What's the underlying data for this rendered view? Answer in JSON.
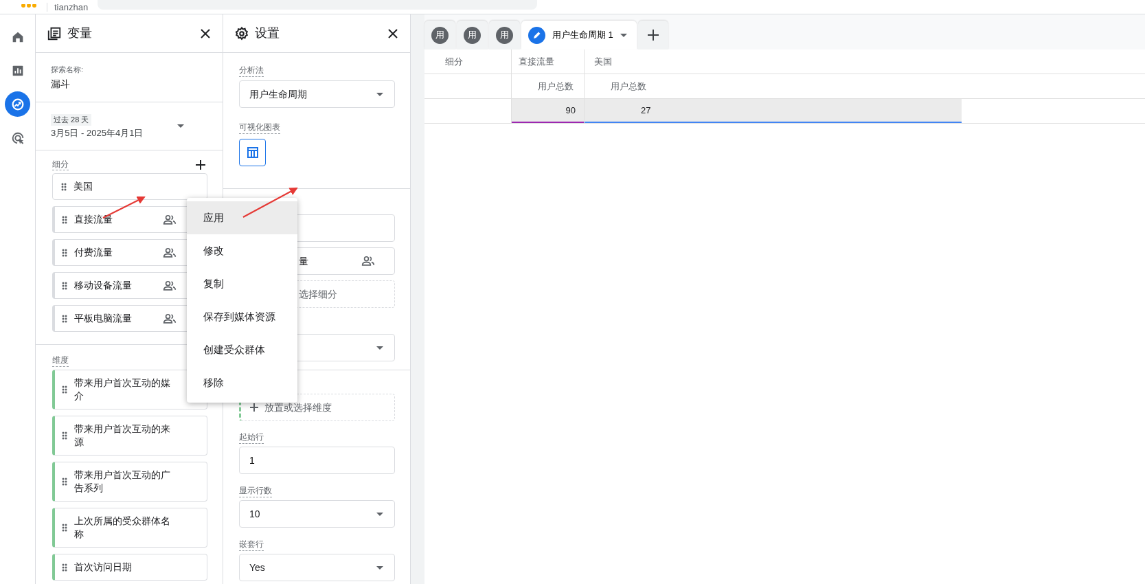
{
  "top_bar": {
    "text": "tianzhan"
  },
  "nav_rail": [
    {
      "kind": "home",
      "selected": false
    },
    {
      "kind": "reports",
      "selected": false
    },
    {
      "kind": "explore",
      "selected": true
    },
    {
      "kind": "advertising",
      "selected": false
    }
  ],
  "variables_panel": {
    "title": "变量",
    "exploration_name": {
      "label": "探索名称:",
      "value": "漏斗"
    },
    "date_range": {
      "preset": "过去 28 天",
      "range": "3月5日 - 2025年4月1日"
    },
    "segments": {
      "heading": "细分",
      "items": [
        {
          "name": "美国",
          "kind": "plain"
        },
        {
          "name": "直接流量",
          "kind": "audience"
        },
        {
          "name": "付费流量",
          "kind": "audience"
        },
        {
          "name": "移动设备流量",
          "kind": "audience"
        },
        {
          "name": "平板电脑流量",
          "kind": "audience"
        }
      ]
    },
    "dimensions": {
      "heading": "维度",
      "items": [
        "带来用户首次互动的媒介",
        "带来用户首次互动的来源",
        "带来用户首次互动的广告系列",
        "上次所属的受众群体名称",
        "首次访问日期"
      ]
    }
  },
  "settings_panel": {
    "title": "设置",
    "technique": {
      "label": "分析法",
      "value": "用户生命周期"
    },
    "visualization": {
      "label": "可视化图表"
    },
    "segment_chip_text": "量",
    "segment_drop_hint": "选择细分",
    "dimension_drop_hint": "放置或选择维度",
    "start_row": {
      "label": "起始行",
      "value": "1"
    },
    "rows_shown": {
      "label": "显示行数",
      "value": "10"
    },
    "nested_rows": {
      "label": "嵌套行",
      "value": "Yes"
    }
  },
  "context_menu": [
    {
      "label": "应用",
      "highlighted": true
    },
    {
      "label": "修改",
      "highlighted": false
    },
    {
      "label": "复制",
      "highlighted": false
    },
    {
      "label": "保存到媒体资源",
      "highlighted": false
    },
    {
      "label": "创建受众群体",
      "highlighted": false
    },
    {
      "label": "移除",
      "highlighted": false
    }
  ],
  "tabs": [
    {
      "kind": "avatar",
      "label": "用",
      "selected": false
    },
    {
      "kind": "avatar",
      "label": "用",
      "selected": false
    },
    {
      "kind": "avatar",
      "label": "用",
      "selected": false
    },
    {
      "kind": "edit",
      "label": "用户生命周期 1",
      "selected": true
    },
    {
      "kind": "add",
      "selected": false
    }
  ],
  "table": {
    "row_header": "细分",
    "segments": [
      {
        "name": "直接流量",
        "metric": "用户总数",
        "value": "90",
        "color": "#9c27b0"
      },
      {
        "name": "美国",
        "metric": "用户总数",
        "value": "27",
        "color": "#4285f4"
      }
    ]
  }
}
